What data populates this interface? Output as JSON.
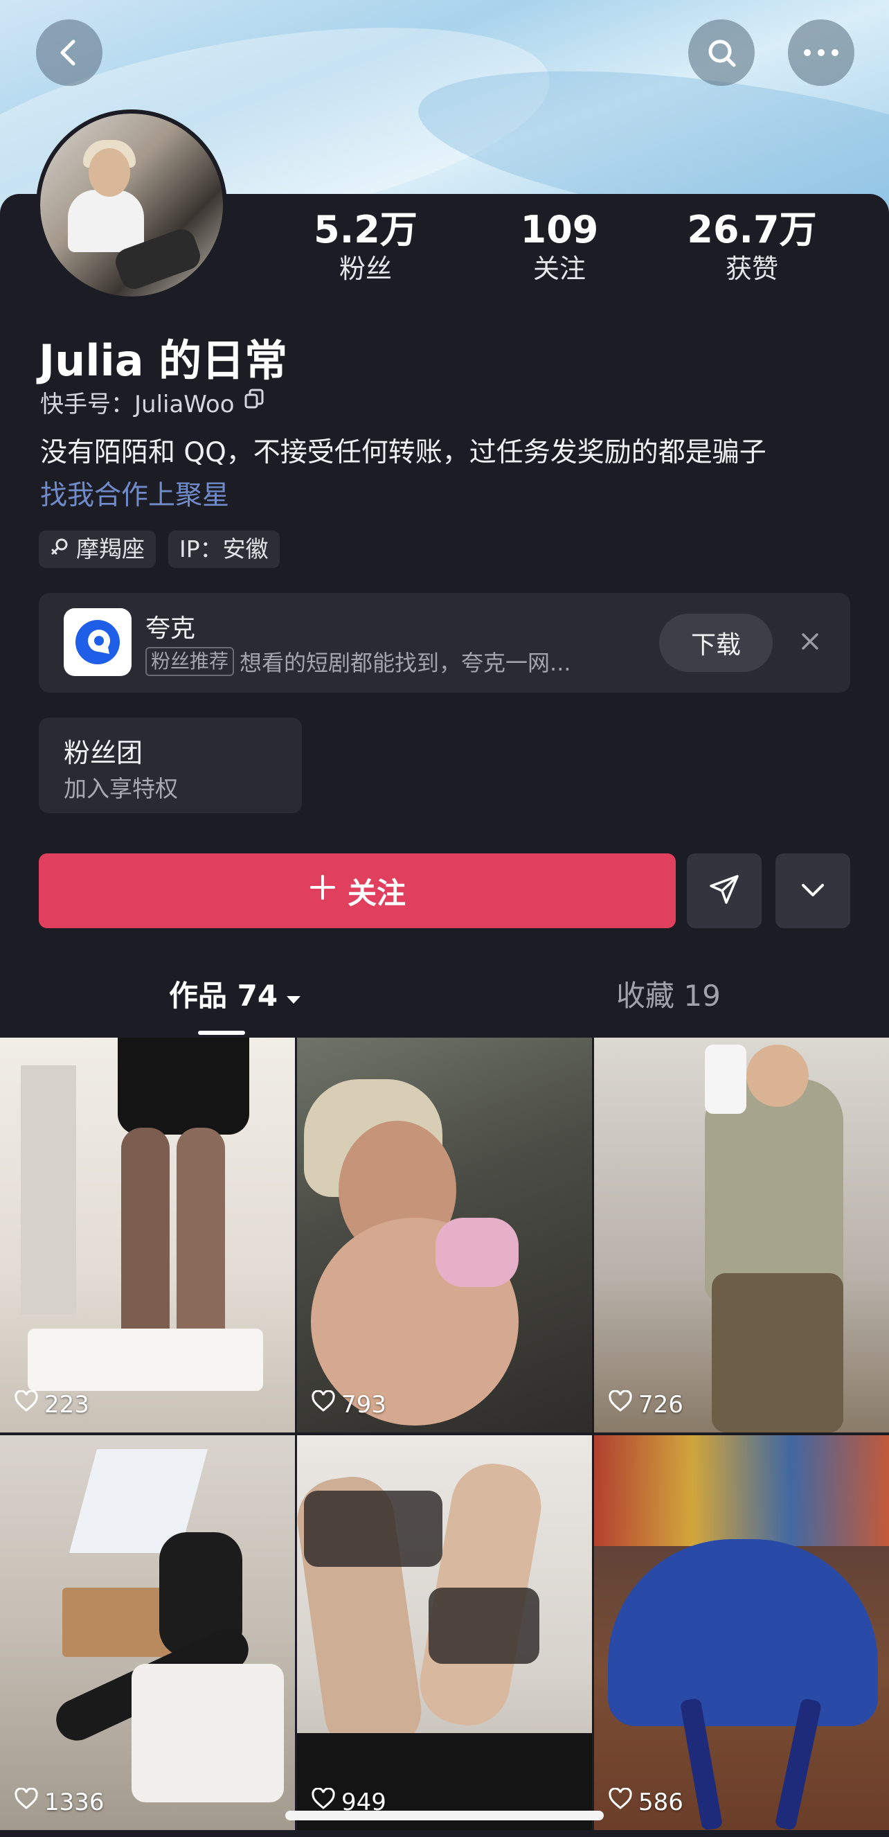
{
  "header": {
    "back_icon": "chevron-left-icon",
    "search_icon": "search-icon",
    "more_icon": "more-horizontal-icon"
  },
  "profile": {
    "name": "Julia 的日常",
    "kuaishou_id_label": "快手号：JuliaWoo",
    "bio": "没有陌陌和 QQ，不接受任何转账，过任务发奖励的都是骗子",
    "bio_link": "找我合作上聚星",
    "tags": [
      "摩羯座",
      "IP：安徽"
    ]
  },
  "stats": [
    {
      "value": "5.2万",
      "label": "粉丝"
    },
    {
      "value": "109",
      "label": "关注"
    },
    {
      "value": "26.7万",
      "label": "获赞"
    }
  ],
  "ad": {
    "title": "夸克",
    "badge": "粉丝推荐",
    "description": "想看的短剧都能找到，夸克一网...",
    "download_label": "下载"
  },
  "fanclub": {
    "title": "粉丝团",
    "subtitle": "加入享特权"
  },
  "actions": {
    "follow_label": "关注"
  },
  "tabs": [
    {
      "label": "作品 74"
    },
    {
      "label": "收藏 19"
    }
  ],
  "posts": [
    {
      "likes": "223"
    },
    {
      "likes": "793"
    },
    {
      "likes": "726"
    },
    {
      "likes": "1336"
    },
    {
      "likes": "949"
    },
    {
      "likes": "586"
    }
  ],
  "colors": {
    "background": "#1c1c24",
    "accent": "#e0405e",
    "link": "#6f8bc9"
  }
}
